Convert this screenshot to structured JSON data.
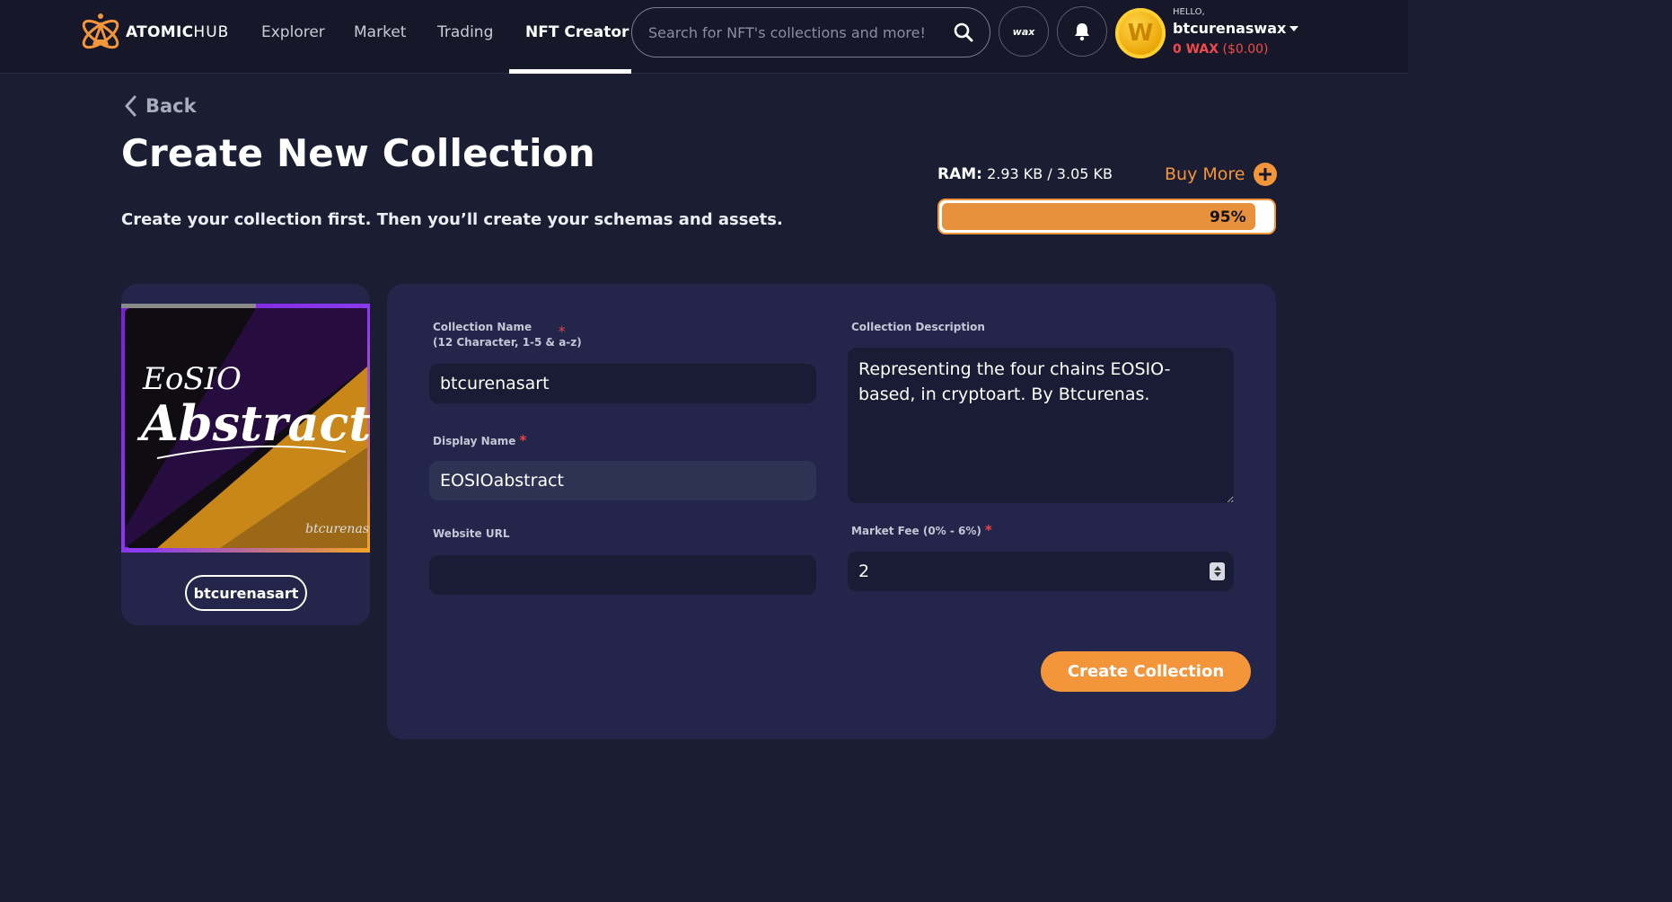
{
  "header": {
    "logo": {
      "brand_bold": "ATOMIC",
      "brand_light": "HUB"
    },
    "nav": [
      {
        "label": "Explorer"
      },
      {
        "label": "Market"
      },
      {
        "label": "Trading"
      },
      {
        "label": "NFT Creator",
        "active": true
      }
    ],
    "search": {
      "placeholder": "Search for NFT's collections and more!"
    },
    "wax_button_label": "wax",
    "user": {
      "hello": "HELLO,",
      "name": "btcurenaswax",
      "balance_wax": "0 WAX",
      "balance_usd": "($0.00)",
      "avatar_letter": "W"
    }
  },
  "page": {
    "back_label": "Back",
    "title": "Create New Collection",
    "subtitle": "Create your collection first. Then you’ll create your schemas and assets."
  },
  "ram": {
    "label": "RAM:",
    "value": "2.93 KB / 3.05 KB",
    "buy_more": "Buy More",
    "percent": 95,
    "percent_label": "95%"
  },
  "preview": {
    "image_text_top": "EoSIO",
    "image_text_main": "Abstract",
    "image_signature": "btcurenas",
    "collection_name": "btcurenasart"
  },
  "form": {
    "collection_name_label": "Collection Name",
    "collection_name_hint": "(12 Character, 1-5 & a-z)",
    "collection_name_value": "btcurenasart",
    "display_name_label": "Display Name",
    "display_name_value": "EOSIOabstract",
    "website_label": "Website URL",
    "website_value": "",
    "description_label": "Collection Description",
    "description_value": "Representing the four chains EOSIO-based, in cryptoart. By Btcurenas.",
    "market_fee_label": "Market Fee (0% - 6%)",
    "market_fee_value": "2",
    "required_mark": "*",
    "submit_label": "Create Collection"
  },
  "colors": {
    "accent": "#f3963b",
    "background": "#1b1d33",
    "card": "#23264a",
    "required": "#e84545",
    "balance": "#f04a4a"
  }
}
